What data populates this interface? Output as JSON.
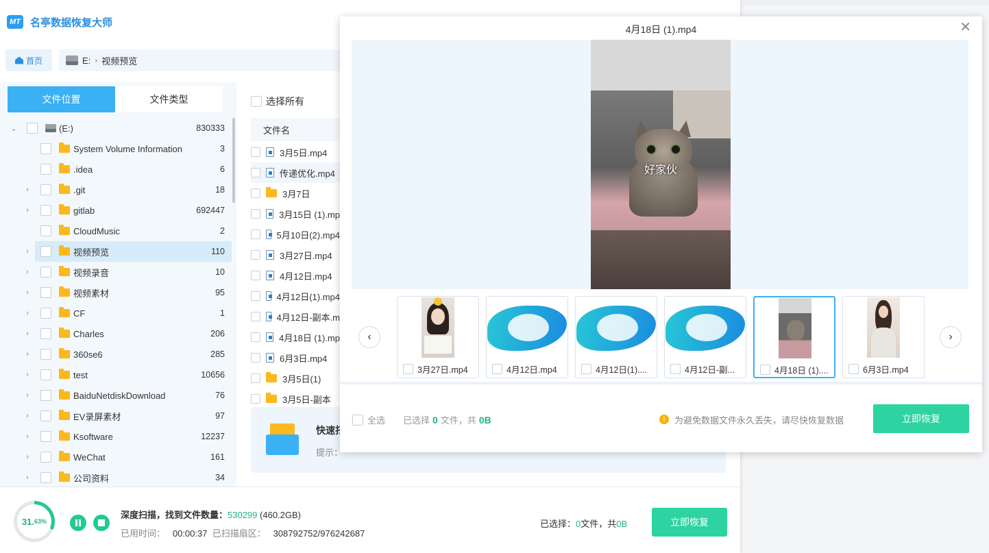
{
  "app": {
    "title": "名亭数据恢复大师",
    "logo_text": "MT"
  },
  "nav": {
    "home_label": "首页",
    "drive": "E:",
    "current_folder": "视频预览"
  },
  "tabs": [
    "文件位置",
    "文件类型"
  ],
  "tree": [
    {
      "name": "(E:)",
      "count": "830333"
    },
    {
      "name": "System Volume Information",
      "count": "3"
    },
    {
      "name": ".idea",
      "count": "6"
    },
    {
      "name": ".git",
      "count": "18"
    },
    {
      "name": "gitlab",
      "count": "692447"
    },
    {
      "name": "CloudMusic",
      "count": "2"
    },
    {
      "name": "视频预览",
      "count": "110"
    },
    {
      "name": "视频录音",
      "count": "10"
    },
    {
      "name": "视频素材",
      "count": "95"
    },
    {
      "name": "CF",
      "count": "1"
    },
    {
      "name": "Charles",
      "count": "206"
    },
    {
      "name": "360se6",
      "count": "285"
    },
    {
      "name": "test",
      "count": "10656"
    },
    {
      "name": "BaiduNetdiskDownload",
      "count": "76"
    },
    {
      "name": "EV录屏素材",
      "count": "97"
    },
    {
      "name": "Ksoftware",
      "count": "12237"
    },
    {
      "name": "WeChat",
      "count": "161"
    },
    {
      "name": "公司资料",
      "count": "34"
    }
  ],
  "file_list": {
    "select_all": "选择所有",
    "col_name": "文件名",
    "files": [
      {
        "name": "3月5日.mp4",
        "type": "video"
      },
      {
        "name": "传递优化.mp4",
        "type": "video"
      },
      {
        "name": "3月7日",
        "type": "folder"
      },
      {
        "name": "3月15日 (1).mp",
        "type": "video"
      },
      {
        "name": "5月10日(2).mp4",
        "type": "video"
      },
      {
        "name": "3月27日.mp4",
        "type": "video"
      },
      {
        "name": "4月12日.mp4",
        "type": "video"
      },
      {
        "name": "4月12日(1).mp4",
        "type": "video"
      },
      {
        "name": "4月12日-副本.m",
        "type": "video"
      },
      {
        "name": "4月18日 (1).mp",
        "type": "video"
      },
      {
        "name": "6月3日.mp4",
        "type": "video"
      },
      {
        "name": "3月5日(1)",
        "type": "folder"
      },
      {
        "name": "3月5日-副本",
        "type": "folder"
      }
    ],
    "quick_title": "快速扫",
    "quick_tip": "提示："
  },
  "bottom": {
    "progress_value": "31.",
    "progress_decimal": "63%",
    "progress_fraction": 0.3163,
    "scan_label": "深度扫描，找到文件数量：",
    "found_count": "530299",
    "found_size": "(460.2GB)",
    "time_label": "已用时间：",
    "time_value": "00:00:37",
    "sector_label": "已扫描扇区：",
    "sector_value": "308792752/976242687",
    "selected_label": "已选择：",
    "selected_files": "0",
    "selected_mid": "文件，共",
    "selected_size": "0B",
    "recover_label": "立即恢复"
  },
  "preview": {
    "title": "4月18日 (1).mp4",
    "subtitle": "好家伙",
    "thumbs": [
      {
        "label": "3月27日.mp4",
        "kind": "girl"
      },
      {
        "label": "4月12日.mp4",
        "kind": "wave"
      },
      {
        "label": "4月12日(1)....",
        "kind": "wave"
      },
      {
        "label": "4月12日-副...",
        "kind": "wave"
      },
      {
        "label": "4月18日 (1)....",
        "kind": "cat",
        "active": true
      },
      {
        "label": "6月3日.mp4",
        "kind": "girl2"
      }
    ],
    "select_all": "全选",
    "selected_prefix": "已选择",
    "selected_files": "0",
    "selected_mid": "文件，共",
    "selected_size": "0B",
    "warning": "为避免数据文件永久丢失，请尽快恢复数据",
    "recover_label": "立即恢复"
  },
  "colors": {
    "accent_blue": "#3ab0f5",
    "accent_green": "#2dd3a0",
    "folder": "#fcb81c"
  }
}
